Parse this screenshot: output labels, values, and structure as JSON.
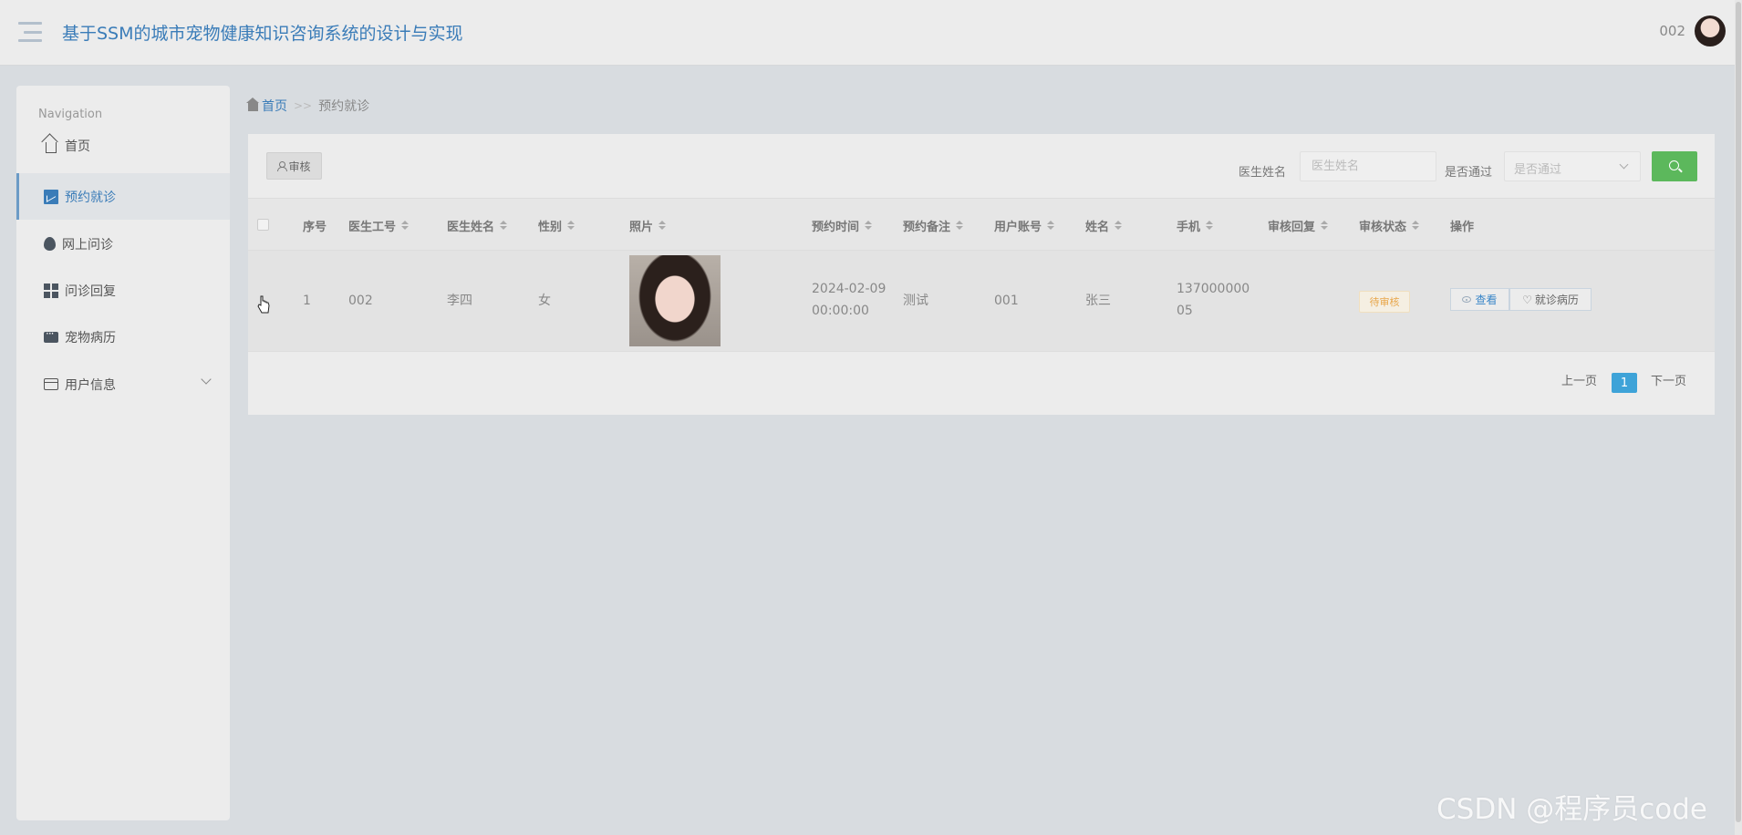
{
  "header": {
    "title": "基于SSM的城市宠物健康知识咨询系统的设计与实现",
    "user": "002"
  },
  "sidebar": {
    "caption": "Navigation",
    "items": [
      {
        "label": "首页",
        "icon": "home-icon"
      },
      {
        "label": "预约就诊",
        "icon": "chart-icon",
        "active": true
      },
      {
        "label": "网上问诊",
        "icon": "bulb-icon"
      },
      {
        "label": "问诊回复",
        "icon": "grid-icon"
      },
      {
        "label": "宠物病历",
        "icon": "chat-icon"
      },
      {
        "label": "用户信息",
        "icon": "wallet-icon",
        "expandable": true
      }
    ]
  },
  "breadcrumb": {
    "home": "首页",
    "separator": ">>",
    "current": "预约就诊"
  },
  "toolbar": {
    "audit_label": "审核",
    "doctor_name_label": "医生姓名",
    "doctor_name_placeholder": "医生姓名",
    "approved_label": "是否通过",
    "approved_placeholder": "是否通过"
  },
  "table": {
    "columns": [
      "序号",
      "医生工号",
      "医生姓名",
      "性别",
      "照片",
      "预约时间",
      "预约备注",
      "用户账号",
      "姓名",
      "手机",
      "审核回复",
      "审核状态",
      "操作"
    ],
    "rows": [
      {
        "index": "1",
        "doctor_id": "002",
        "doctor_name": "李四",
        "gender": "女",
        "time_line1": "2024-02-09",
        "time_line2": "00:00:00",
        "note": "测试",
        "account": "001",
        "name": "张三",
        "phone_line1": "137000000",
        "phone_line2": "05",
        "reply": "",
        "status": "待审核",
        "action_view": "查看",
        "action_record": "就诊病历"
      }
    ]
  },
  "pagination": {
    "prev": "上一页",
    "current": "1",
    "next": "下一页"
  },
  "watermark": "CSDN @程序员code",
  "colors": {
    "accent": "#3a7cb8",
    "search_button": "#5cb85c",
    "page_active": "#3ea3d8",
    "pending_badge": "#e8a64a"
  }
}
